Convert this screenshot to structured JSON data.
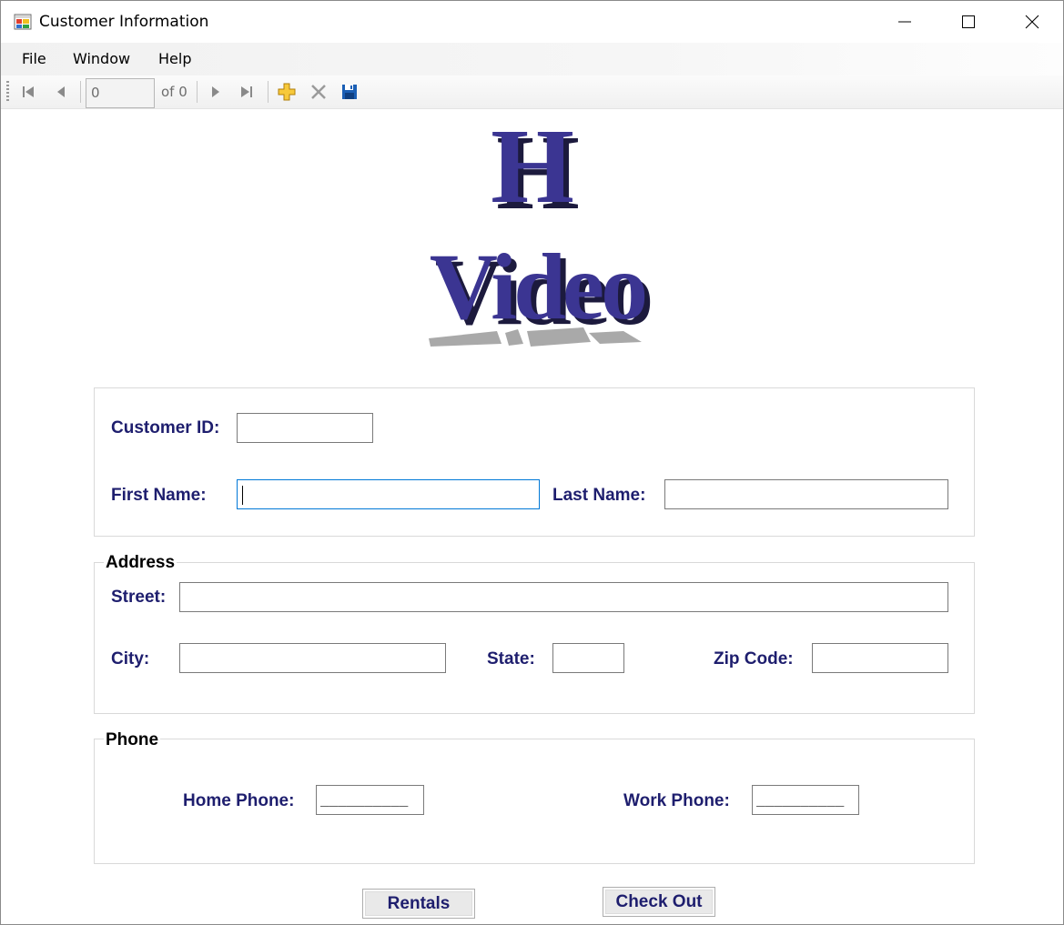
{
  "window": {
    "title": "Customer Information",
    "controls": {
      "minimize": "minimize-icon",
      "maximize": "maximize-icon",
      "close": "close-icon"
    }
  },
  "menu": {
    "items": [
      {
        "label": "File"
      },
      {
        "label": "Window"
      },
      {
        "label": "Help"
      }
    ]
  },
  "navigator": {
    "position": "0",
    "count_label": "of 0",
    "icons": [
      "move-first-icon",
      "move-previous-icon",
      "move-next-icon",
      "move-last-icon",
      "add-new-icon",
      "delete-icon",
      "save-icon"
    ]
  },
  "logo": {
    "letter": "H",
    "word": "Video",
    "colors": {
      "face": "#3b3592",
      "shadow": "#1c1a3d",
      "reflection": "#a9a9a9"
    }
  },
  "customer": {
    "id_label": "Customer ID:",
    "id_value": "",
    "first_name_label": "First Name:",
    "first_name_value": "",
    "last_name_label": "Last Name:",
    "last_name_value": ""
  },
  "address": {
    "group_title": "Address",
    "street_label": "Street:",
    "street_value": "",
    "city_label": "City:",
    "city_value": "",
    "state_label": "State:",
    "state_value": "",
    "zip_label": "Zip Code:",
    "zip_value": ""
  },
  "phone": {
    "group_title": "Phone",
    "home_label": "Home Phone:",
    "home_value": "__________",
    "work_label": "Work Phone:",
    "work_value": "__________"
  },
  "buttons": {
    "rentals": "Rentals",
    "checkout": "Check Out"
  },
  "colors": {
    "label_text": "#1e1e6e",
    "focus_border": "#0078d7",
    "field_border": "#7a7a7a",
    "group_border": "#d9d9d9"
  }
}
